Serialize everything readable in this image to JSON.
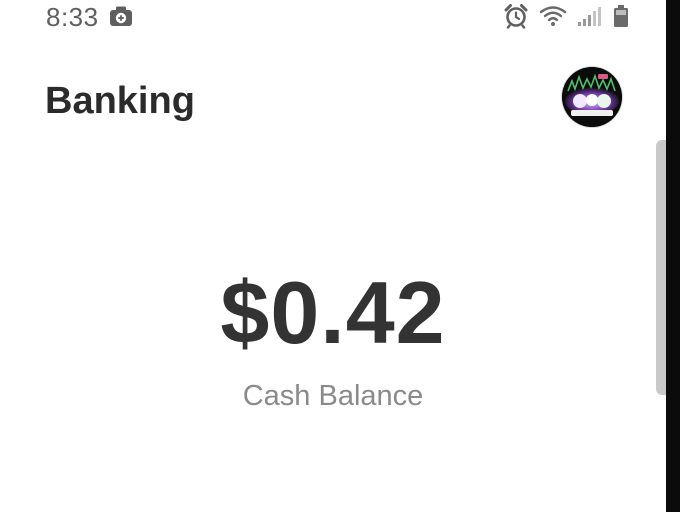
{
  "status_bar": {
    "time": "8:33",
    "icons": [
      "camera-icon",
      "alarm-icon",
      "wifi-icon",
      "signal-icon",
      "battery-icon"
    ]
  },
  "header": {
    "title": "Banking",
    "avatar_icon": "profile-avatar"
  },
  "balance": {
    "amount": "$0.42",
    "label": "Cash Balance"
  },
  "colors": {
    "text_primary": "#333333",
    "text_secondary": "#8a8a8a",
    "status_text": "#5f5f5f",
    "background": "#ffffff"
  }
}
